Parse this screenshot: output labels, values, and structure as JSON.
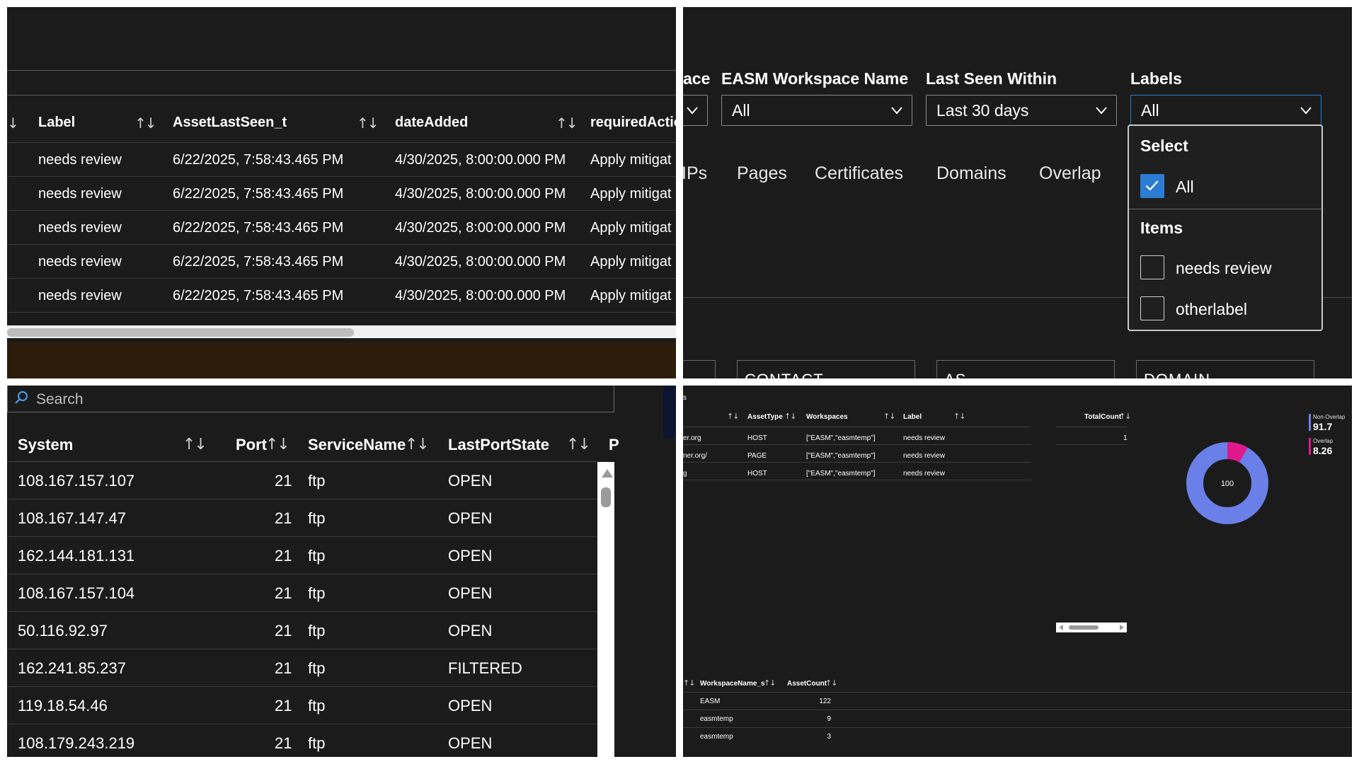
{
  "panel1": {
    "headers": [
      "Label",
      "AssetLastSeen_t",
      "dateAdded",
      "requiredActio"
    ],
    "rows": [
      {
        "label": "needs review",
        "lastSeen": "6/22/2025, 7:58:43.465 PM",
        "dateAdded": "4/30/2025, 8:00:00.000 PM",
        "action": "Apply mitigat"
      },
      {
        "label": "needs review",
        "lastSeen": "6/22/2025, 7:58:43.465 PM",
        "dateAdded": "4/30/2025, 8:00:00.000 PM",
        "action": "Apply mitigat"
      },
      {
        "label": "needs review",
        "lastSeen": "6/22/2025, 7:58:43.465 PM",
        "dateAdded": "4/30/2025, 8:00:00.000 PM",
        "action": "Apply mitigat"
      },
      {
        "label": "needs review",
        "lastSeen": "6/22/2025, 7:58:43.465 PM",
        "dateAdded": "4/30/2025, 8:00:00.000 PM",
        "action": "Apply mitigat"
      },
      {
        "label": "needs review",
        "lastSeen": "6/22/2025, 7:58:43.465 PM",
        "dateAdded": "4/30/2025, 8:00:00.000 PM",
        "action": "Apply mitigat"
      }
    ]
  },
  "panel2": {
    "filters": [
      {
        "label": "ace",
        "value": ""
      },
      {
        "label": "EASM Workspace Name",
        "value": "All"
      },
      {
        "label": "Last Seen Within",
        "value": "Last 30 days"
      },
      {
        "label": "Labels",
        "value": "All"
      }
    ],
    "tabs": [
      "IPs",
      "Pages",
      "Certificates",
      "Domains",
      "Overlap"
    ],
    "cards": [
      "",
      "CONTACT",
      "AS",
      "DOMAIN"
    ],
    "dropdown": {
      "select_heading": "Select",
      "all_label": "All",
      "items_heading": "Items",
      "items": [
        "needs review",
        "otherlabel"
      ]
    }
  },
  "panel3": {
    "search_placeholder": "Search",
    "headers": [
      "System",
      "Port",
      "ServiceName",
      "LastPortState",
      "P"
    ],
    "rows": [
      {
        "system": "108.167.157.107",
        "port": "21",
        "service": "ftp",
        "state": "OPEN"
      },
      {
        "system": "108.167.147.47",
        "port": "21",
        "service": "ftp",
        "state": "OPEN"
      },
      {
        "system": "162.144.181.131",
        "port": "21",
        "service": "ftp",
        "state": "OPEN"
      },
      {
        "system": "108.167.157.104",
        "port": "21",
        "service": "ftp",
        "state": "OPEN"
      },
      {
        "system": "50.116.92.97",
        "port": "21",
        "service": "ftp",
        "state": "OPEN"
      },
      {
        "system": "162.241.85.237",
        "port": "21",
        "service": "ftp",
        "state": "FILTERED"
      },
      {
        "system": "119.18.54.46",
        "port": "21",
        "service": "ftp",
        "state": "OPEN"
      },
      {
        "system": "108.179.243.219",
        "port": "21",
        "service": "ftp",
        "state": "OPEN"
      }
    ]
  },
  "panel4": {
    "title_fragment": "s",
    "asset_headers": [
      "AssetType",
      "Workspaces",
      "Label"
    ],
    "asset_rows": [
      {
        "name": "er.org",
        "type": "HOST",
        "workspaces": "[\"EASM\",\"easmtemp\"]",
        "label": "needs review"
      },
      {
        "name": "ner.org/",
        "type": "PAGE",
        "workspaces": "[\"EASM\",\"easmtemp\"]",
        "label": "needs review"
      },
      {
        "name": "g",
        "type": "HOST",
        "workspaces": "[\"EASM\",\"easmtemp\"]",
        "label": "needs review"
      }
    ],
    "total_header": "TotalCount",
    "total_value": "1",
    "donut_center": "100",
    "legend": [
      {
        "name": "Non-Overlap",
        "value": "91.7",
        "color": "#6b7fe8"
      },
      {
        "name": "Overlap",
        "value": "8.26",
        "color": "#e0188c"
      }
    ],
    "ws_headers": [
      "WorkspaceName_s",
      "AssetCount"
    ],
    "ws_rows": [
      {
        "name": "EASM",
        "count": "122"
      },
      {
        "name": "easmtemp",
        "count": "9"
      },
      {
        "name": "easmtemp",
        "count": "3"
      }
    ]
  }
}
